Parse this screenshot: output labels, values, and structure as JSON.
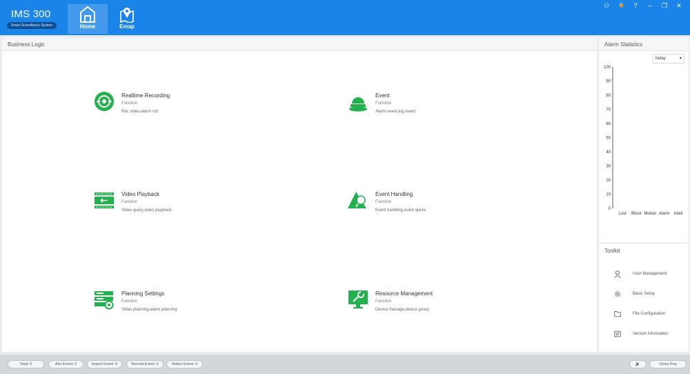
{
  "app": {
    "name": "IMS 300",
    "subtitle": "Smart Surveillance System"
  },
  "nav": [
    {
      "label": "Home",
      "icon": "home-icon",
      "active": true
    },
    {
      "label": "Emap",
      "icon": "map-pin-icon",
      "active": false
    }
  ],
  "window_controls": [
    {
      "icon": "user-icon",
      "glyph": "⚇"
    },
    {
      "icon": "lock-icon",
      "glyph": "🔒"
    },
    {
      "icon": "help-icon",
      "glyph": "?"
    },
    {
      "icon": "minimize-icon",
      "glyph": "–"
    },
    {
      "icon": "restore-icon",
      "glyph": "❐"
    },
    {
      "icon": "close-icon",
      "glyph": "✕"
    }
  ],
  "business": {
    "title": "Business Logic",
    "functions": [
      {
        "title": "Realtime Recording",
        "sub": "Function",
        "desc": "Rec video,alarm roll",
        "icon": "recording-icon"
      },
      {
        "title": "Event",
        "sub": "Function",
        "desc": "Alarm event,log event",
        "icon": "alarm-light-icon"
      },
      {
        "title": "Video Playback",
        "sub": "Function",
        "desc": "Video query,video playback",
        "icon": "playback-icon"
      },
      {
        "title": "Event Handling",
        "sub": "Function",
        "desc": "Event handling,event quere",
        "icon": "event-handling-icon"
      },
      {
        "title": "Planning Settings",
        "sub": "Function",
        "desc": "Video planning,alarm planning",
        "icon": "planning-icon"
      },
      {
        "title": "Resource Management",
        "sub": "Function",
        "desc": "Device manage,device group",
        "icon": "wrench-monitor-icon"
      }
    ]
  },
  "alarm": {
    "title": "Alarm Statistics",
    "period": "today"
  },
  "chart_data": {
    "type": "bar",
    "categories": [
      "Lost",
      "Block",
      "Motion",
      "Alarm",
      "Intell"
    ],
    "values": [
      0,
      0,
      0,
      0,
      0
    ],
    "ylim": [
      0,
      100
    ],
    "yticks": [
      0,
      10,
      20,
      30,
      40,
      50,
      60,
      70,
      80,
      90,
      100
    ]
  },
  "toolkit": {
    "title": "Toolkit",
    "items": [
      {
        "label": "User Management",
        "icon": "user-icon"
      },
      {
        "label": "Basic Setup",
        "icon": "gear-icon"
      },
      {
        "label": "File Configuration",
        "icon": "folder-icon"
      },
      {
        "label": "Version Information",
        "icon": "info-icon"
      }
    ]
  },
  "footer": {
    "counters": [
      "Total: 0",
      "Alm Event: 0",
      "Import Event: 0",
      "Normal Event: 0",
      "Notice Event: 0"
    ],
    "close_popup": "Close Pop"
  },
  "colors": {
    "header": "#1a84e8",
    "accent_green": "#22b14c"
  }
}
